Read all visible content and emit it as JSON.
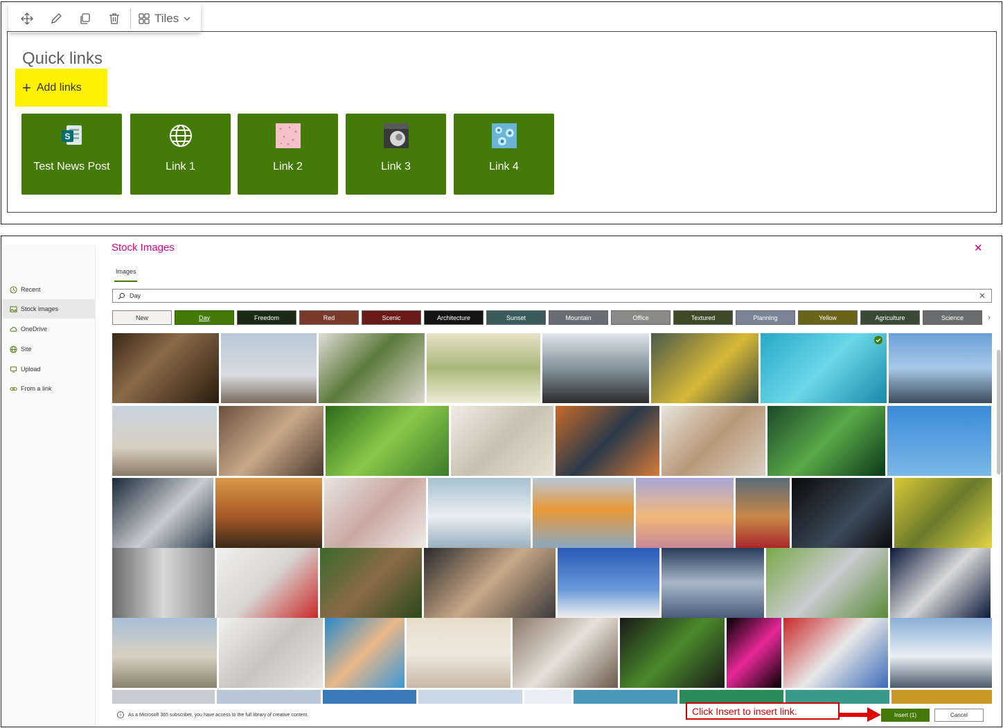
{
  "toolbar": {
    "items": [
      {
        "icon": "move-icon"
      },
      {
        "icon": "edit-icon"
      },
      {
        "icon": "duplicate-icon"
      },
      {
        "icon": "delete-icon"
      }
    ],
    "layout_label": "Tiles"
  },
  "quick_links": {
    "title": "Quick links",
    "add_label": "Add links",
    "tiles": [
      {
        "label": "Test News Post",
        "icon": "sharepoint-news-icon"
      },
      {
        "label": "Link 1",
        "icon": "globe-icon"
      },
      {
        "label": "Link 2",
        "icon": "pink-thumbnail"
      },
      {
        "label": "Link 3",
        "icon": "gray-thumbnail"
      },
      {
        "label": "Link 4",
        "icon": "blue-thumbnail"
      }
    ]
  },
  "stock": {
    "title": "Stock Images",
    "close_icon": "close-icon",
    "nav": [
      {
        "label": "Recent",
        "icon": "clock-icon"
      },
      {
        "label": "Stock images",
        "icon": "image-icon",
        "active": true
      },
      {
        "label": "OneDrive",
        "icon": "cloud-icon"
      },
      {
        "label": "Site",
        "icon": "globe-icon"
      },
      {
        "label": "Upload",
        "icon": "monitor-icon"
      },
      {
        "label": "From a link",
        "icon": "link-icon"
      }
    ],
    "tab": "Images",
    "search": {
      "value": "Day",
      "placeholder": ""
    },
    "chips": [
      {
        "label": "New",
        "color": "#f3f2f1"
      },
      {
        "label": "Day",
        "color": "#447a08"
      },
      {
        "label": "Freedom",
        "color": "#1a2a14"
      },
      {
        "label": "Red",
        "color": "#7a3a2a"
      },
      {
        "label": "Scenic",
        "color": "#6a1a18"
      },
      {
        "label": "Architecture",
        "color": "#141414"
      },
      {
        "label": "Sunset",
        "color": "#3c5a5c"
      },
      {
        "label": "Mountain",
        "color": "#6a6e72"
      },
      {
        "label": "Office",
        "color": "#8a8a88"
      },
      {
        "label": "Textured",
        "color": "#3c4a2a"
      },
      {
        "label": "Planning",
        "color": "#7a8496"
      },
      {
        "label": "Yellow",
        "color": "#6a6418"
      },
      {
        "label": "Agriculture",
        "color": "#3a4a34"
      },
      {
        "label": "Science",
        "color": "#6a6c6e"
      }
    ],
    "footer_note": "As a Microsoft 365 subscriber, you have access to the full library of creative content.",
    "insert_label": "Insert (1)",
    "cancel_label": "Cancel",
    "callout": "Click Insert to insert link."
  }
}
